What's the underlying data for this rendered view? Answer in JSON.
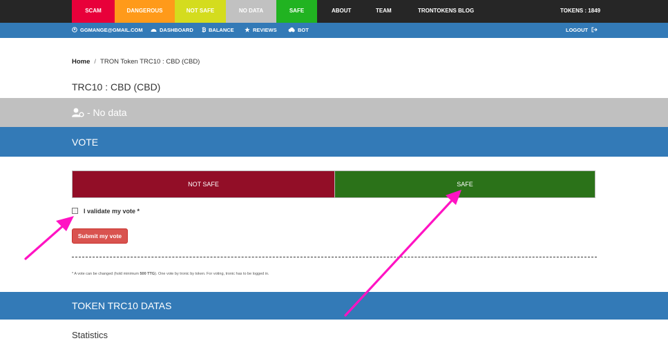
{
  "topnav": {
    "categories": [
      {
        "label": "SCAM",
        "color": "#e8003a"
      },
      {
        "label": "DANGEROUS",
        "color": "#ff9a1a"
      },
      {
        "label": "NOT SAFE",
        "color": "#d4dc1e"
      },
      {
        "label": "NO DATA",
        "color": "#c1c1c1"
      },
      {
        "label": "SAFE",
        "color": "#21b321"
      }
    ],
    "about": "ABOUT",
    "team": "TEAM",
    "blog": "TRONTOKENS BLOG",
    "tokens": "TOKENS : 1849"
  },
  "subnav": {
    "email": "GGMANGE@GMAIL.COM",
    "dashboard": "DASHBOARD",
    "balance": "BALANCE",
    "reviews": "REVIEWS",
    "bot": "BOT",
    "logout": "LOGOUT"
  },
  "breadcrumb": {
    "home": "Home",
    "separator": "/",
    "current": "TRON Token TRC10 : CBD (CBD)"
  },
  "page_title": "TRC10 : CBD (CBD)",
  "status_band": {
    "text": "- No data",
    "color": "#c0c0c0"
  },
  "vote": {
    "heading": "VOTE",
    "not_safe_label": "NOT SAFE",
    "safe_label": "SAFE",
    "not_safe_color": "#920e27",
    "safe_color": "#2b7219",
    "validate_label": "I validate my vote *",
    "submit_label": "Submit my vote",
    "note_prefix": "* A vote can be changed (hold minimum ",
    "note_bold": "500 TTG",
    "note_suffix": "). One vote by tronic by token. For voting, tronic has to be logged in."
  },
  "datas": {
    "heading": "TOKEN TRC10 DATAS",
    "statistics": "Statistics"
  },
  "colors": {
    "accent": "#337ab7",
    "annotation_arrow": "#ff13c3"
  }
}
